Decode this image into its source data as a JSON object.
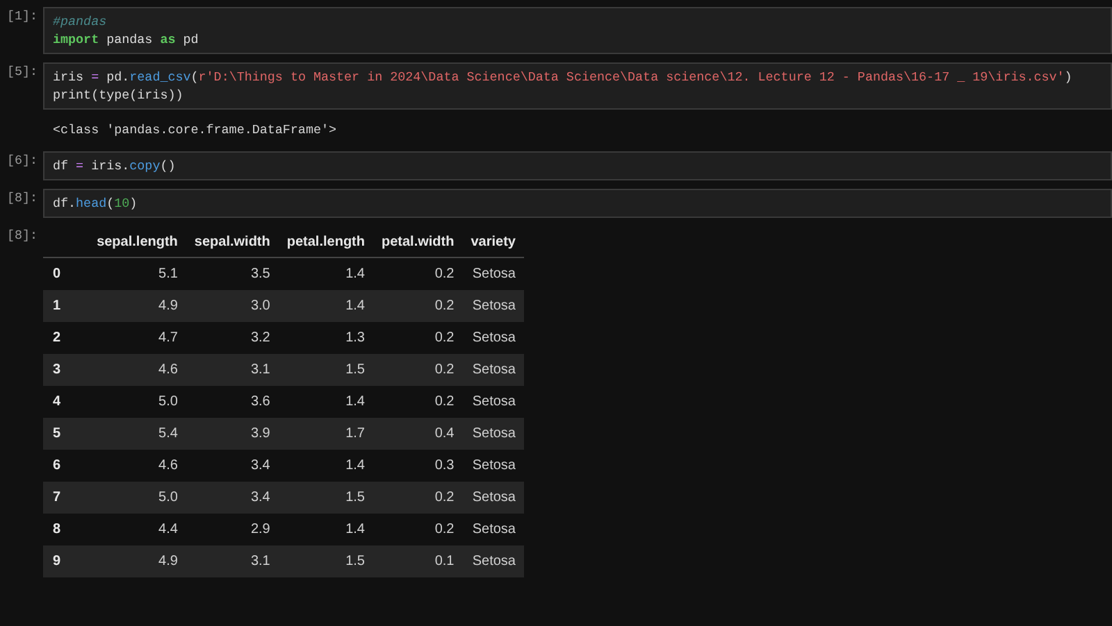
{
  "cells": [
    {
      "prompt": "[1]:",
      "lines": [
        [
          {
            "kind": "comment",
            "text": "#pandas"
          }
        ],
        [
          {
            "kind": "keyword",
            "text": "import"
          },
          {
            "kind": "plain",
            "text": " pandas "
          },
          {
            "kind": "keyword",
            "text": "as"
          },
          {
            "kind": "plain",
            "text": " pd"
          }
        ]
      ]
    },
    {
      "prompt": "[5]:",
      "lines": [
        [
          {
            "kind": "plain",
            "text": "iris "
          },
          {
            "kind": "operator",
            "text": "="
          },
          {
            "kind": "plain",
            "text": " pd."
          },
          {
            "kind": "function",
            "text": "read_csv"
          },
          {
            "kind": "plain",
            "text": "("
          },
          {
            "kind": "string",
            "text": "r'D:\\Things to Master in 2024\\Data Science\\Data Science\\Data science\\12. Lecture 12 - Pandas\\16-17 _ 19\\iris.csv'"
          },
          {
            "kind": "plain",
            "text": ")"
          }
        ],
        [
          {
            "kind": "plain",
            "text": "print(type(iris))"
          }
        ]
      ],
      "output": {
        "kind": "stream",
        "text": "<class 'pandas.core.frame.DataFrame'>"
      }
    },
    {
      "prompt": "[6]:",
      "lines": [
        [
          {
            "kind": "plain",
            "text": "df "
          },
          {
            "kind": "operator",
            "text": "="
          },
          {
            "kind": "plain",
            "text": " iris."
          },
          {
            "kind": "function",
            "text": "copy"
          },
          {
            "kind": "plain",
            "text": "()"
          }
        ]
      ]
    },
    {
      "prompt": "[8]:",
      "lines": [
        [
          {
            "kind": "plain",
            "text": "df."
          },
          {
            "kind": "function",
            "text": "head"
          },
          {
            "kind": "plain",
            "text": "("
          },
          {
            "kind": "number",
            "text": "10"
          },
          {
            "kind": "plain",
            "text": ")"
          }
        ]
      ],
      "output": {
        "kind": "table",
        "prompt": "[8]:",
        "columns": [
          "sepal.length",
          "sepal.width",
          "petal.length",
          "petal.width",
          "variety"
        ],
        "rows": [
          {
            "index": "0",
            "cells": [
              "5.1",
              "3.5",
              "1.4",
              "0.2",
              "Setosa"
            ]
          },
          {
            "index": "1",
            "cells": [
              "4.9",
              "3.0",
              "1.4",
              "0.2",
              "Setosa"
            ]
          },
          {
            "index": "2",
            "cells": [
              "4.7",
              "3.2",
              "1.3",
              "0.2",
              "Setosa"
            ]
          },
          {
            "index": "3",
            "cells": [
              "4.6",
              "3.1",
              "1.5",
              "0.2",
              "Setosa"
            ]
          },
          {
            "index": "4",
            "cells": [
              "5.0",
              "3.6",
              "1.4",
              "0.2",
              "Setosa"
            ]
          },
          {
            "index": "5",
            "cells": [
              "5.4",
              "3.9",
              "1.7",
              "0.4",
              "Setosa"
            ]
          },
          {
            "index": "6",
            "cells": [
              "4.6",
              "3.4",
              "1.4",
              "0.3",
              "Setosa"
            ]
          },
          {
            "index": "7",
            "cells": [
              "5.0",
              "3.4",
              "1.5",
              "0.2",
              "Setosa"
            ]
          },
          {
            "index": "8",
            "cells": [
              "4.4",
              "2.9",
              "1.4",
              "0.2",
              "Setosa"
            ]
          },
          {
            "index": "9",
            "cells": [
              "4.9",
              "3.1",
              "1.5",
              "0.1",
              "Setosa"
            ]
          }
        ]
      }
    }
  ]
}
